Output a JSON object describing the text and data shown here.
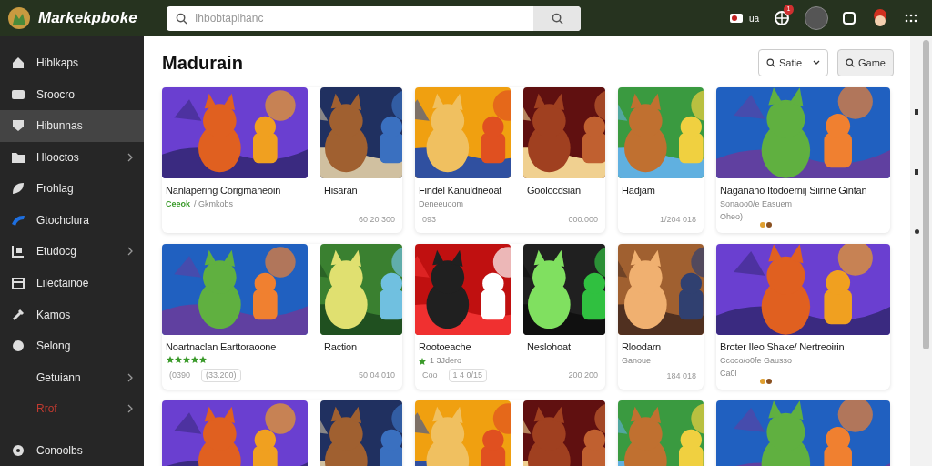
{
  "topbar": {
    "brand": "Markekpboke",
    "search": {
      "placeholder": "Ihbobtapihanc"
    },
    "cart_label": "ua",
    "notification_count": "1"
  },
  "sidebar": {
    "items": [
      {
        "label": "Hiblkaps",
        "selected": false,
        "chevron": false,
        "kind": "normal"
      },
      {
        "label": "Sroocro",
        "selected": false,
        "chevron": false,
        "kind": "normal"
      },
      {
        "label": "Hibunnas",
        "selected": true,
        "chevron": false,
        "kind": "normal"
      },
      {
        "label": "Hlooctos",
        "selected": false,
        "chevron": true,
        "kind": "normal"
      },
      {
        "label": "Frohlag",
        "selected": false,
        "chevron": false,
        "kind": "normal"
      },
      {
        "label": "Gtochclura",
        "selected": false,
        "chevron": false,
        "kind": "normal"
      },
      {
        "label": "Etudocg",
        "selected": false,
        "chevron": true,
        "kind": "normal"
      },
      {
        "label": "Lilectainoe",
        "selected": false,
        "chevron": false,
        "kind": "normal"
      },
      {
        "label": "Kamos",
        "selected": false,
        "chevron": false,
        "kind": "normal"
      },
      {
        "label": "Selong",
        "selected": false,
        "chevron": false,
        "kind": "normal"
      },
      {
        "label": "Getuiann",
        "selected": false,
        "chevron": true,
        "kind": "normal"
      },
      {
        "label": "Rrof",
        "selected": false,
        "chevron": true,
        "kind": "danger"
      },
      {
        "label": "Conoolbs",
        "selected": false,
        "chevron": false,
        "kind": "normal"
      }
    ]
  },
  "main": {
    "title": "Madurain",
    "sort": {
      "value": "Satie"
    },
    "button": "Game",
    "rows": [
      {
        "cards": [
          {
            "items": [
              {
                "title": "Nanlapering Corigmaneoin",
                "badge": "Ceeok",
                "lines": [
                  "/ Gkmkobs"
                ]
              },
              {
                "title": "Hisaran"
              }
            ],
            "price": "60 20 300"
          },
          {
            "items": [
              {
                "title": "Findel Kanuldneoat",
                "lines": [
                  "Deneeuoom"
                ]
              },
              {
                "title": "Goolocdsian"
              }
            ],
            "footer": [
              "093"
            ],
            "price": "000:000"
          },
          {
            "items": [
              {
                "title": "Hadjam"
              }
            ],
            "price": "1/204 018"
          },
          {
            "items": [
              {
                "title": "Naganaho Itodoernij Siirine Gintan",
                "lines": [
                  "Sonaoo0/e Easuem",
                  "Oheo)"
                ]
              }
            ]
          }
        ]
      },
      {
        "cards": [
          {
            "items": [
              {
                "title": "Noartnaclan Earttoraoone",
                "stars": 5
              },
              {
                "title": "Raction"
              }
            ],
            "footer": [
              "(0390",
              "(33.200)"
            ],
            "price": "50 04 010"
          },
          {
            "items": [
              {
                "title": "Rootoeache",
                "rated": "1 3Jdero"
              },
              {
                "title": "Neslohoat"
              }
            ],
            "footer": [
              "Coo",
              "1 4 0/15"
            ],
            "price": "200 200"
          },
          {
            "items": [
              {
                "title": "Rloodarn",
                "lines": [
                  "Ganoue"
                ]
              }
            ],
            "price": "184 018"
          },
          {
            "items": [
              {
                "title": "Broter Ileo Shake/ Nertreoirin",
                "lines": [
                  "Ccoco/o0fe Gausso",
                  "Ca0l"
                ]
              }
            ]
          }
        ]
      },
      {
        "cards": [
          {
            "items": [
              {
                "kind": "picture"
              },
              {
                "kind": "picture"
              }
            ]
          },
          {
            "items": [
              {
                "kind": "picture"
              },
              {
                "kind": "picture"
              }
            ]
          },
          {
            "items": [
              {
                "kind": "picture"
              }
            ]
          },
          {
            "items": [
              {
                "kind": "picture"
              }
            ]
          }
        ]
      }
    ]
  }
}
